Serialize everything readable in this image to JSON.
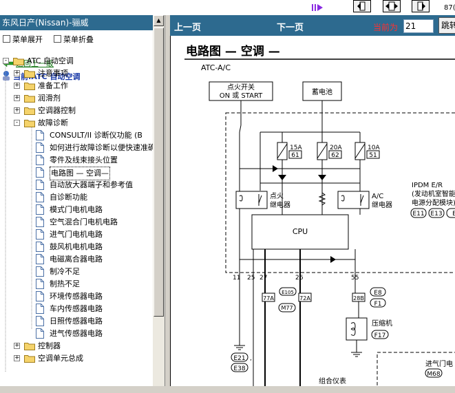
{
  "left": {
    "title": "东风日产(Nissan)-骊威",
    "menu_expand": "菜单展开",
    "menu_collapse": "菜单折叠",
    "back": "返回上一级",
    "current": "当前:ATC 自动空调",
    "tree": [
      {
        "level": 0,
        "type": "folder",
        "expand": "-",
        "label": "ATC 自动空调"
      },
      {
        "level": 1,
        "type": "folder",
        "expand": "+",
        "label": "注意事项"
      },
      {
        "level": 1,
        "type": "folder",
        "expand": "+",
        "label": "准备工作"
      },
      {
        "level": 1,
        "type": "folder",
        "expand": "+",
        "label": "润滑剂"
      },
      {
        "level": 1,
        "type": "folder",
        "expand": "+",
        "label": "空调器控制"
      },
      {
        "level": 1,
        "type": "folder",
        "expand": "-",
        "label": "故障诊断"
      },
      {
        "level": 2,
        "type": "doc",
        "label": "CONSULT/II 诊断仪功能 (B"
      },
      {
        "level": 2,
        "type": "doc",
        "label": "如何进行故障诊断以便快速准确"
      },
      {
        "level": 2,
        "type": "doc",
        "label": "零件及线束接头位置"
      },
      {
        "level": 2,
        "type": "doc",
        "label": "电路图 — 空调—",
        "selected": true
      },
      {
        "level": 2,
        "type": "doc",
        "label": "自动放大器端子和参考值"
      },
      {
        "level": 2,
        "type": "doc",
        "label": "自诊断功能"
      },
      {
        "level": 2,
        "type": "doc",
        "label": "模式门电机电路"
      },
      {
        "level": 2,
        "type": "doc",
        "label": "空气混合门电机电路"
      },
      {
        "level": 2,
        "type": "doc",
        "label": "进气门电机电路"
      },
      {
        "level": 2,
        "type": "doc",
        "label": "鼓风机电机电路"
      },
      {
        "level": 2,
        "type": "doc",
        "label": "电磁离合器电路"
      },
      {
        "level": 2,
        "type": "doc",
        "label": "制冷不足"
      },
      {
        "level": 2,
        "type": "doc",
        "label": "制热不足"
      },
      {
        "level": 2,
        "type": "doc",
        "label": "环境传感器电路"
      },
      {
        "level": 2,
        "type": "doc",
        "label": "车内传感器电路"
      },
      {
        "level": 2,
        "type": "doc",
        "label": "日照传感器电路"
      },
      {
        "level": 2,
        "type": "doc",
        "label": "进气传感器电路"
      },
      {
        "level": 1,
        "type": "folder",
        "expand": "+",
        "label": "控制器"
      },
      {
        "level": 1,
        "type": "folder",
        "expand": "+",
        "label": "空调单元总成"
      }
    ]
  },
  "right": {
    "prev": "上一页",
    "next": "下一页",
    "current_label": "当前为",
    "current_value": "21",
    "jump": "跳转",
    "top_right_partial": "87(",
    "diagram": {
      "title": "电路图 — 空调 —",
      "subtitle": "ATC-A/C",
      "ignition_line1": "点火开关",
      "ignition_line2": "ON 或 START",
      "battery": "蓄电池",
      "fuses": [
        {
          "amp": "15A",
          "num": "61"
        },
        {
          "amp": "20A",
          "num": "62"
        },
        {
          "amp": "10A",
          "num": "51"
        }
      ],
      "relay_left_1": "点火",
      "relay_left_2": "继电器",
      "relay_right_1": "A/C",
      "relay_right_2": "继电器",
      "cpu": "CPU",
      "ipdm_1": "IPDM E/R",
      "ipdm_2": "(发动机室智能",
      "ipdm_3": "电源分配模块)",
      "ipdm_conns": [
        "E11",
        "E13",
        "E"
      ],
      "pins": [
        "11",
        "25",
        "27",
        "26",
        "55"
      ],
      "conn_77a": "77A",
      "conn_72a": "72A",
      "conn_e105": "E105",
      "conn_m77": "M77",
      "conn_28b": "28B",
      "conn_e8": "E8",
      "conn_f1": "F1",
      "compressor": "压缩机",
      "conn_f17": "F17",
      "ground_e21": "E21",
      "ground_e38": "E38",
      "intake_partial": "进气门电",
      "conn_m68": "M68",
      "combination_meter": "组合仪表"
    }
  }
}
